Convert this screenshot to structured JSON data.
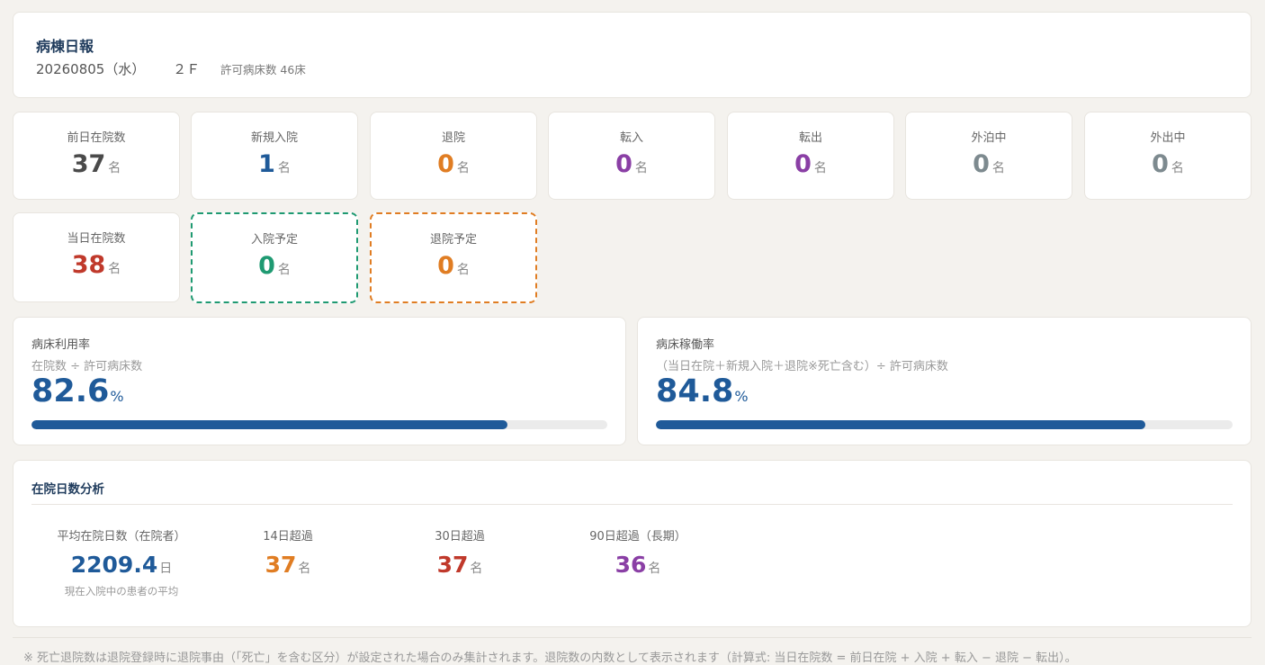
{
  "header": {
    "title": "病棟日報",
    "date": "20260805（水）",
    "floor": "２Ｆ",
    "licensed_beds": "許可病床数 46床"
  },
  "unit": "名",
  "stats": [
    {
      "label": "前日在院数",
      "value": "37",
      "color": "#4a4a4a"
    },
    {
      "label": "新規入院",
      "value": "1",
      "color": "#1f5a99"
    },
    {
      "label": "退院",
      "value": "0",
      "color": "#e07d23"
    },
    {
      "label": "転入",
      "value": "0",
      "color": "#8a3fa5"
    },
    {
      "label": "転出",
      "value": "0",
      "color": "#8a3fa5"
    },
    {
      "label": "外泊中",
      "value": "0",
      "color": "#7d8a8f"
    },
    {
      "label": "外出中",
      "value": "0",
      "color": "#7d8a8f"
    },
    {
      "label": "当日在院数",
      "value": "38",
      "color": "#c0392b"
    },
    {
      "label": "入院予定",
      "value": "0",
      "color": "#1f9a72"
    },
    {
      "label": "退院予定",
      "value": "0",
      "color": "#e07d23"
    }
  ],
  "rates": {
    "utilization": {
      "label": "病床利用率",
      "formula": "在院数 ÷ 許可病床数",
      "value": "82.6",
      "unit": "%",
      "percent": 82.6
    },
    "operation": {
      "label": "病床稼働率",
      "formula": "（当日在院＋新規入院＋退院※死亡含む）÷ 許可病床数",
      "value": "84.8",
      "unit": "%",
      "percent": 84.8
    }
  },
  "analysis": {
    "title": "在院日数分析",
    "avg": {
      "label": "平均在院日数（在院者）",
      "value": "2209.4",
      "unit": "日",
      "note": "現在入院中の患者の平均"
    },
    "over14": {
      "label": "14日超過",
      "value": "37",
      "unit": "名"
    },
    "over30": {
      "label": "30日超過",
      "value": "37",
      "unit": "名"
    },
    "over90": {
      "label": "90日超過（長期）",
      "value": "36",
      "unit": "名"
    }
  },
  "footnote": "※ 死亡退院数は退院登録時に退院事由（「死亡」を含む区分）が設定された場合のみ集計されます。退院数の内数として表示されます（計算式: 当日在院数 = 前日在院 + 入院 + 転入 − 退院 − 転出）。",
  "colors": {
    "accent": "#1f5a99",
    "title": "#1f3b5c",
    "background": "#f4f2ee"
  }
}
